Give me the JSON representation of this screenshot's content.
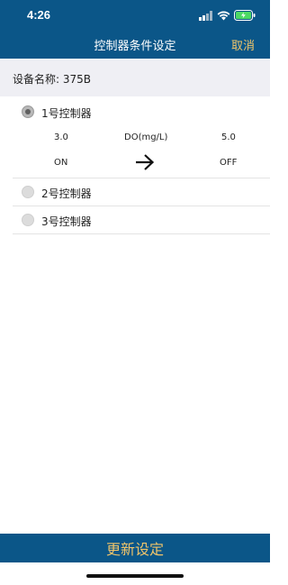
{
  "status_bar": {
    "time": "4:26"
  },
  "nav": {
    "title": "控制器条件设定",
    "cancel_label": "取消"
  },
  "device": {
    "label": "设备名称: 375B"
  },
  "controllers": [
    {
      "label": "1号控制器",
      "selected": true
    },
    {
      "label": "2号控制器",
      "selected": false
    },
    {
      "label": "3号控制器",
      "selected": false
    }
  ],
  "condition": {
    "low_value": "3.0",
    "parameter": "DO(mg/L)",
    "high_value": "5.0",
    "start_state": "ON",
    "end_state": "OFF",
    "arrow_icon": "arrow-right-icon"
  },
  "footer": {
    "update_label": "更新设定"
  },
  "colors": {
    "navbar": "#0b5688",
    "accent": "#f0c46a",
    "section_bg": "#efeff4"
  }
}
